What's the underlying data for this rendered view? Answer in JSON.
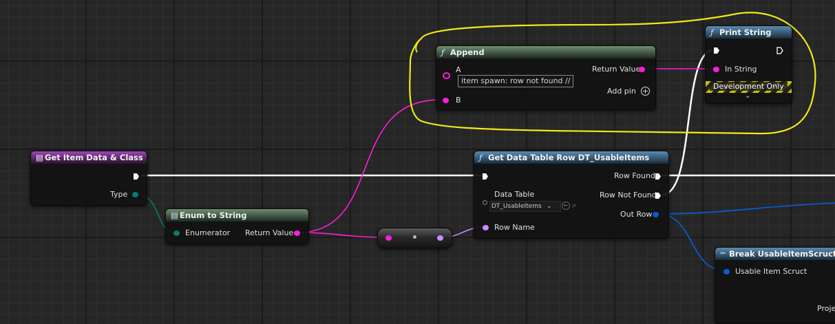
{
  "nodes": {
    "get_item": {
      "title": "Get Item Data & Class",
      "type_pin": "Type"
    },
    "enum_to_string": {
      "title": "Enum to String",
      "enumerator_pin": "Enumerator",
      "return_pin": "Return Value"
    },
    "append": {
      "title": "Append",
      "pin_a": "A",
      "pin_a_value": "item spawn: row not found //",
      "pin_b": "B",
      "return_pin": "Return Value",
      "add_pin": "Add pin"
    },
    "print_string": {
      "title": "Print String",
      "in_string_pin": "In String",
      "dev_only": "Development Only"
    },
    "get_row": {
      "title": "Get Data Table Row DT_UsableItems",
      "data_table_pin": "Data Table",
      "data_table_value": "DT_UsableItems",
      "row_name_pin": "Row Name",
      "row_found_pin": "Row Found",
      "row_not_found_pin": "Row Not Found",
      "out_row_pin": "Out Row"
    },
    "break_struct": {
      "title": "Break UsableItemScruct",
      "input_pin": "Usable Item Scruct",
      "partial_label": "Proje"
    }
  },
  "colors": {
    "exec": "#ffffff",
    "string": "#ff1ddc",
    "enum": "#00786a",
    "name": "#c98bff",
    "struct": "#0a5bd0",
    "highlight": "#f3ea16"
  }
}
